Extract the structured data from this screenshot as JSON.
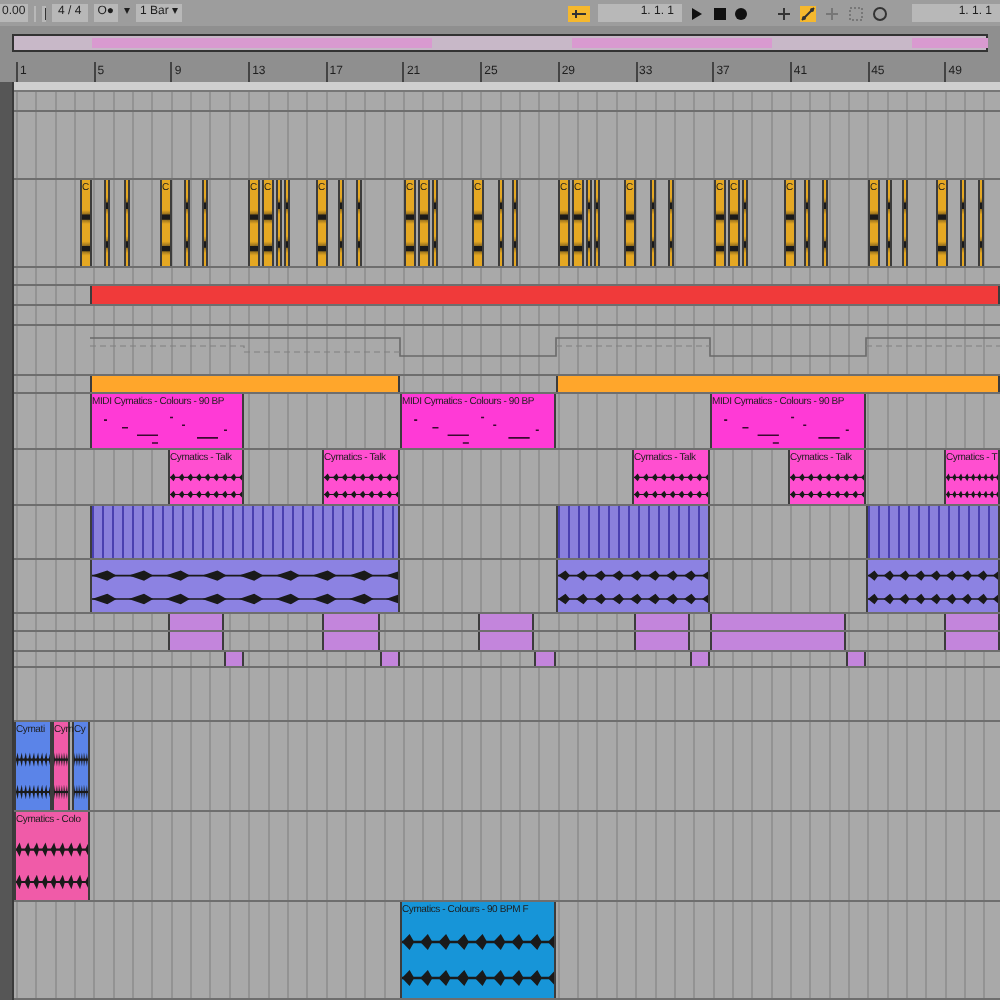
{
  "toolbar": {
    "tempo": "0.00",
    "signature": "4 / 4",
    "follow": "O●",
    "follow_caret": "▾",
    "quantize": "1 Bar ▾",
    "position": "1. 1. 1",
    "loop_start": "1. 1. 1"
  },
  "ruler": {
    "marks": [
      "1",
      "5",
      "9",
      "13",
      "17",
      "21",
      "25",
      "29",
      "33",
      "37",
      "41",
      "45",
      "49"
    ]
  },
  "tracks": [
    {
      "kind": "empty"
    },
    {
      "kind": "empty"
    },
    {
      "kind": "clips",
      "color": "#e5a823",
      "clips": [
        {
          "kind": "audio",
          "label": "C"
        },
        {
          "kind": "audio"
        },
        {
          "kind": "audio"
        },
        {
          "kind": "audio",
          "label": "C"
        },
        {
          "kind": "audio"
        },
        {
          "kind": "audio"
        },
        {
          "kind": "audio",
          "label": "C"
        },
        {
          "kind": "audio",
          "label": "C"
        },
        {
          "kind": "audio"
        },
        {
          "kind": "audio"
        },
        {
          "kind": "audio",
          "label": "C"
        },
        {
          "kind": "audio"
        },
        {
          "kind": "audio"
        },
        {
          "kind": "audio",
          "label": "C"
        },
        {
          "kind": "audio",
          "label": "C"
        },
        {
          "kind": "audio"
        },
        {
          "kind": "audio",
          "label": "C"
        },
        {
          "kind": "audio"
        },
        {
          "kind": "audio"
        },
        {
          "kind": "audio",
          "label": "C"
        },
        {
          "kind": "audio",
          "label": "C"
        },
        {
          "kind": "audio"
        },
        {
          "kind": "audio"
        },
        {
          "kind": "audio",
          "label": "C"
        },
        {
          "kind": "audio"
        },
        {
          "kind": "audio"
        },
        {
          "kind": "audio",
          "label": "C"
        },
        {
          "kind": "audio",
          "label": "C"
        },
        {
          "kind": "audio"
        },
        {
          "kind": "audio",
          "label": "C"
        },
        {
          "kind": "audio"
        },
        {
          "kind": "audio"
        },
        {
          "kind": "audio",
          "label": "C"
        },
        {
          "kind": "audio"
        },
        {
          "kind": "audio"
        },
        {
          "kind": "audio",
          "label": "C"
        },
        {
          "kind": "audio"
        },
        {
          "kind": "audio"
        }
      ]
    },
    {
      "kind": "empty"
    },
    {
      "kind": "clips",
      "color": "#f03a3a",
      "clips": [
        {
          "kind": "plain"
        }
      ]
    },
    {
      "kind": "empty"
    },
    {
      "kind": "automation"
    },
    {
      "kind": "clips",
      "color": "#ffa62b",
      "clips": [
        {
          "kind": "plain"
        },
        {
          "kind": "plain"
        }
      ]
    },
    {
      "kind": "clips",
      "color": "#ff3ad6",
      "clips": [
        {
          "kind": "midi",
          "label": "MIDI Cymatics - Colours - 90 BP"
        },
        {
          "kind": "midi",
          "label": "MIDI Cymatics - Colours - 90 BP"
        },
        {
          "kind": "midi",
          "label": "MIDI Cymatics - Colours - 90 BP"
        }
      ]
    },
    {
      "kind": "clips",
      "color": "#ff4fd0",
      "clips": [
        {
          "kind": "audio",
          "label": "Cymatics - Talk"
        },
        {
          "kind": "audio",
          "label": "Cymatics - Talk"
        },
        {
          "kind": "audio",
          "label": "Cymatics - Talk"
        },
        {
          "kind": "audio",
          "label": "Cymatics - Talk"
        },
        {
          "kind": "audio",
          "label": "Cymatics - T"
        }
      ]
    },
    {
      "kind": "clips",
      "color": "#8a80dc",
      "clips": [
        {
          "kind": "ticks"
        },
        {
          "kind": "ticks"
        },
        {
          "kind": "ticks"
        }
      ]
    },
    {
      "kind": "clips",
      "color": "#8c82e2",
      "clips": [
        {
          "kind": "audio"
        },
        {
          "kind": "audio"
        },
        {
          "kind": "audio"
        }
      ]
    },
    {
      "kind": "clips",
      "color": "#c385dc",
      "clips": [
        {
          "kind": "plain"
        },
        {
          "kind": "plain"
        },
        {
          "kind": "plain"
        },
        {
          "kind": "plain"
        },
        {
          "kind": "plain"
        },
        {
          "kind": "plain"
        }
      ]
    },
    {
      "kind": "clips",
      "color": "#c385dc",
      "clips": [
        {
          "kind": "plain"
        },
        {
          "kind": "plain"
        },
        {
          "kind": "plain"
        },
        {
          "kind": "plain"
        },
        {
          "kind": "plain"
        },
        {
          "kind": "plain"
        }
      ]
    },
    {
      "kind": "clips",
      "color": "#c385dc",
      "clips": [
        {
          "kind": "plain"
        },
        {
          "kind": "plain"
        },
        {
          "kind": "plain"
        },
        {
          "kind": "plain"
        },
        {
          "kind": "plain"
        }
      ]
    },
    {
      "kind": "empty"
    },
    {
      "kind": "clips",
      "clips": [
        {
          "kind": "audio",
          "label": "Cymati",
          "color": "#5b84e8"
        },
        {
          "kind": "audio",
          "label": "Cym",
          "color": "#f05ba8"
        },
        {
          "kind": "audio",
          "label": "Cy",
          "color": "#5b84e8"
        }
      ]
    },
    {
      "kind": "clips",
      "color": "#f05ba8",
      "clips": [
        {
          "kind": "audio",
          "label": "Cymatics - Colo"
        }
      ]
    },
    {
      "kind": "clips",
      "color": "#1795d8",
      "clips": [
        {
          "kind": "audio",
          "label": "Cymatics - Colours - 90 BPM F"
        }
      ]
    }
  ]
}
